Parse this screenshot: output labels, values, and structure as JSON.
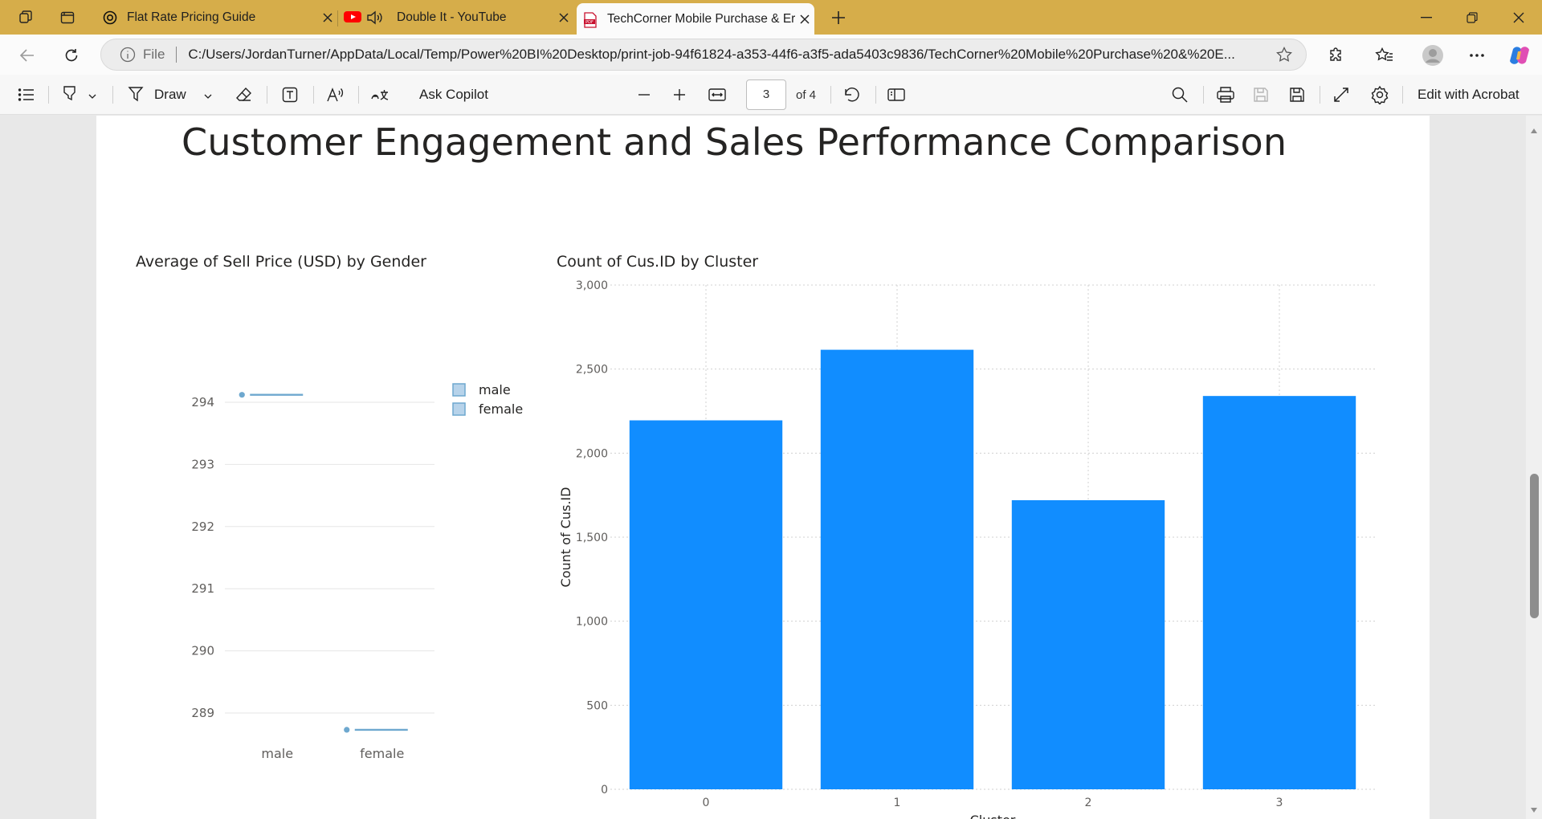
{
  "browser": {
    "tabs": [
      {
        "title": "Flat Rate Pricing Guide",
        "favicon": "openai-icon"
      },
      {
        "title": "Double It - YouTube",
        "favicon": "youtube-icon"
      },
      {
        "title": "TechCorner Mobile Purchase & Er",
        "favicon": "pdf-icon"
      }
    ],
    "address": {
      "scheme_label": "File",
      "url": "C:/Users/JordanTurner/AppData/Local/Temp/Power%20BI%20Desktop/print-job-94f61824-a353-44f6-a3f5-ada5403c9836/TechCorner%20Mobile%20Purchase%20&%20E..."
    }
  },
  "pdf_toolbar": {
    "draw_label": "Draw",
    "copilot_label": "Ask Copilot",
    "page_current": "3",
    "page_total": "of 4",
    "acrobat_label": "Edit with Acrobat"
  },
  "report": {
    "title": "Customer Engagement and Sales Performance Comparison"
  },
  "chart_data": [
    {
      "type": "line",
      "title": "Average of Sell Price (USD) by Gender",
      "categories": [
        "male",
        "female"
      ],
      "series": [
        {
          "name": "male",
          "values": [
            294.12,
            null
          ]
        },
        {
          "name": "female",
          "values": [
            null,
            288.73
          ]
        }
      ],
      "yticks": [
        289,
        290,
        291,
        292,
        293,
        294
      ],
      "ylim": [
        288.4,
        294.5
      ],
      "legend": "right",
      "color": "#6ea8cf"
    },
    {
      "type": "bar",
      "title": "Count of Cus.ID by Cluster",
      "categories": [
        "0",
        "1",
        "2",
        "3"
      ],
      "values": [
        2195,
        2615,
        1720,
        2340
      ],
      "ylabel": "Count of Cus.ID",
      "xlabel": "Cluster",
      "ylim": [
        0,
        3000
      ],
      "yticks": [
        0,
        500,
        1000,
        1500,
        2000,
        2500,
        3000
      ],
      "ytick_labels": [
        "0",
        "500",
        "1,000",
        "1,500",
        "2,000",
        "2,500",
        "3,000"
      ],
      "grid": true,
      "color": "#118dff"
    }
  ]
}
